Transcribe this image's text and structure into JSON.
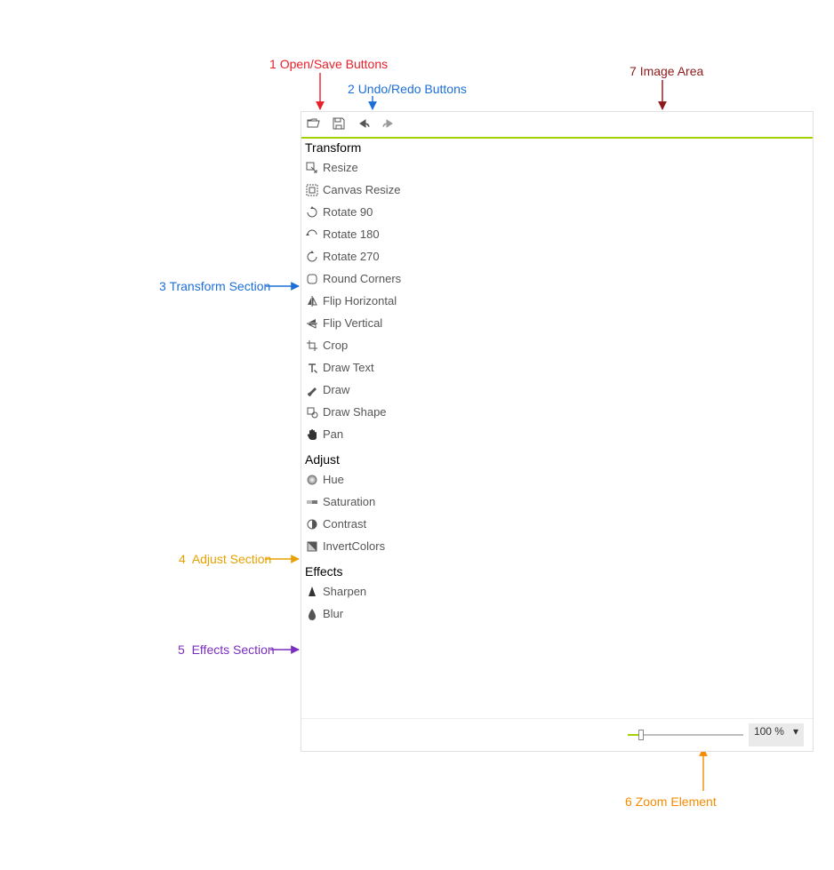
{
  "annotations": {
    "openSave": {
      "n": "1",
      "label": "Open/Save Buttons",
      "color": "#E8202A"
    },
    "undoRedo": {
      "n": "2",
      "label": "Undo/Redo Buttons",
      "color": "#1D6FD8"
    },
    "transform": {
      "n": "3",
      "label": "Transform Section",
      "color": "#1D6FD8"
    },
    "adjust": {
      "n": "4",
      "label": "Adjust Section",
      "color": "#E8A100"
    },
    "effects": {
      "n": "5",
      "label": "Effects Section",
      "color": "#7B2DBF"
    },
    "zoom": {
      "n": "6",
      "label": "Zoom Element",
      "color": "#F58B00"
    },
    "imageArea": {
      "n": "7",
      "label": "Image Area",
      "color": "#8C1A1A"
    }
  },
  "sections": {
    "transform": {
      "title": "Transform",
      "items": [
        {
          "label": "Resize"
        },
        {
          "label": "Canvas Resize"
        },
        {
          "label": "Rotate 90"
        },
        {
          "label": "Rotate 180"
        },
        {
          "label": "Rotate 270"
        },
        {
          "label": "Round Corners"
        },
        {
          "label": "Flip Horizontal"
        },
        {
          "label": "Flip Vertical"
        },
        {
          "label": "Crop"
        },
        {
          "label": "Draw Text"
        },
        {
          "label": "Draw"
        },
        {
          "label": "Draw Shape"
        },
        {
          "label": "Pan"
        }
      ]
    },
    "adjust": {
      "title": "Adjust",
      "items": [
        {
          "label": "Hue"
        },
        {
          "label": "Saturation"
        },
        {
          "label": "Contrast"
        },
        {
          "label": "InvertColors"
        }
      ]
    },
    "effects": {
      "title": "Effects",
      "items": [
        {
          "label": "Sharpen"
        },
        {
          "label": "Blur"
        }
      ]
    }
  },
  "zoom": {
    "value": "100 %"
  }
}
